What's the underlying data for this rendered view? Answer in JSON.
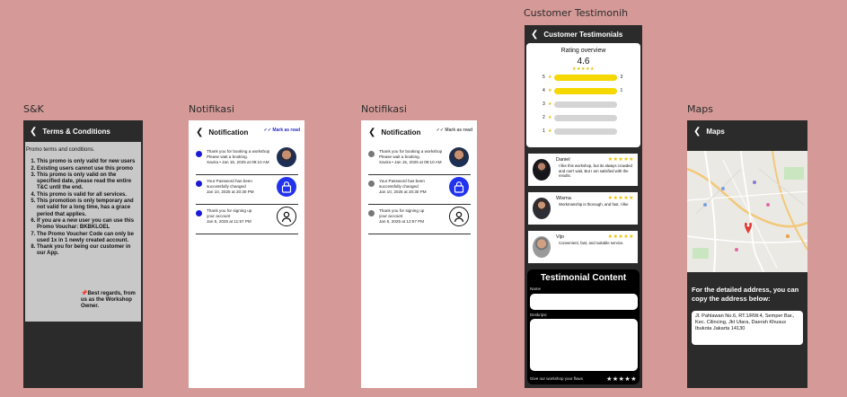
{
  "labels": {
    "sk": "S&K",
    "notif1": "Notifikasi",
    "notif2": "Notifikasi",
    "testimonial": "Customer Testimonih",
    "maps": "Maps"
  },
  "sk": {
    "title": "Terms & Conditions",
    "intro": "Promo terms and conditions.",
    "items": [
      "This promo is only valid for new users",
      "Existing users cannot use this promo",
      "This promo is only valid on the specified date, please read the entire T&C until the end.",
      "This promo is valid for all services.",
      "This promotion is only temporary and not valid for a long time, has a grace period that applies.",
      "If you are a new user you can use this Promo Vouchar: BKBKLOEL",
      "The Promo Voucher Code can only be used 1x in 1 newly created account.",
      "Thank you for being our customer in our App."
    ],
    "regards": "📌Best regards, from us as the Workshop Owner."
  },
  "notif": {
    "title": "Notification",
    "mark_read": "Mark as read",
    "items": [
      {
        "line1": "Thank you for booking a workshop",
        "line2": "Please wait a booking.",
        "line3": "Xavira • Jan 15, 2025 at 09:10 AM",
        "icon": "user-photo"
      },
      {
        "line1": "Your Password has been",
        "line2": "successfully changed",
        "line3": "Jan 10, 2025 at 20:30 PM",
        "icon": "lock-icon"
      },
      {
        "line1": "Thank you for signing up",
        "line2": "your account",
        "line3": "Jan 5, 2025 at 11:57 PM",
        "icon": "user-circle-icon"
      }
    ],
    "items2": [
      {
        "line3": "Jan 5, 2025 at 12:57 PM"
      }
    ]
  },
  "testimonial": {
    "title": "Customer Testimonials",
    "overview_title": "Rating overview",
    "overview_value": "4.6",
    "rows": [
      {
        "star": "5",
        "fill": 1.0,
        "count": "3"
      },
      {
        "star": "4",
        "fill": 1.0,
        "count": "1"
      },
      {
        "star": "3",
        "fill": 0.0,
        "count": ""
      },
      {
        "star": "2",
        "fill": 0.0,
        "count": ""
      },
      {
        "star": "1",
        "fill": 0.0,
        "count": ""
      }
    ],
    "reviews": [
      {
        "name": "Daniel",
        "text": "I like this workshop, but its always crowded and can't wait, But I am satisfied with the results."
      },
      {
        "name": "Wisma",
        "text": "Workmanship is thorough, and fast. I like"
      },
      {
        "name": "Vijo",
        "text": "Convenient, fast, and suitable service."
      }
    ],
    "content_title": "Testimonial Content",
    "name_label": "Name",
    "desc_label": "Deskripsi",
    "give_stars": "Give our workshop your flaws"
  },
  "maps": {
    "title": "Maps",
    "info": "For the detailed address, you can copy the address below:",
    "address": "Jl. Pahlawan No.6, RT.1/RW.4, Semper Bar., Kec. Cilincing, Jkt Utara, Daerah Khusus Ibukota Jakarta 14130"
  },
  "colors": {
    "background": "#d59a98",
    "dark": "#2b2b2b",
    "star": "#e8c000",
    "unread_dot": "#1a1ad6",
    "bar_fill": "#f5d800"
  }
}
